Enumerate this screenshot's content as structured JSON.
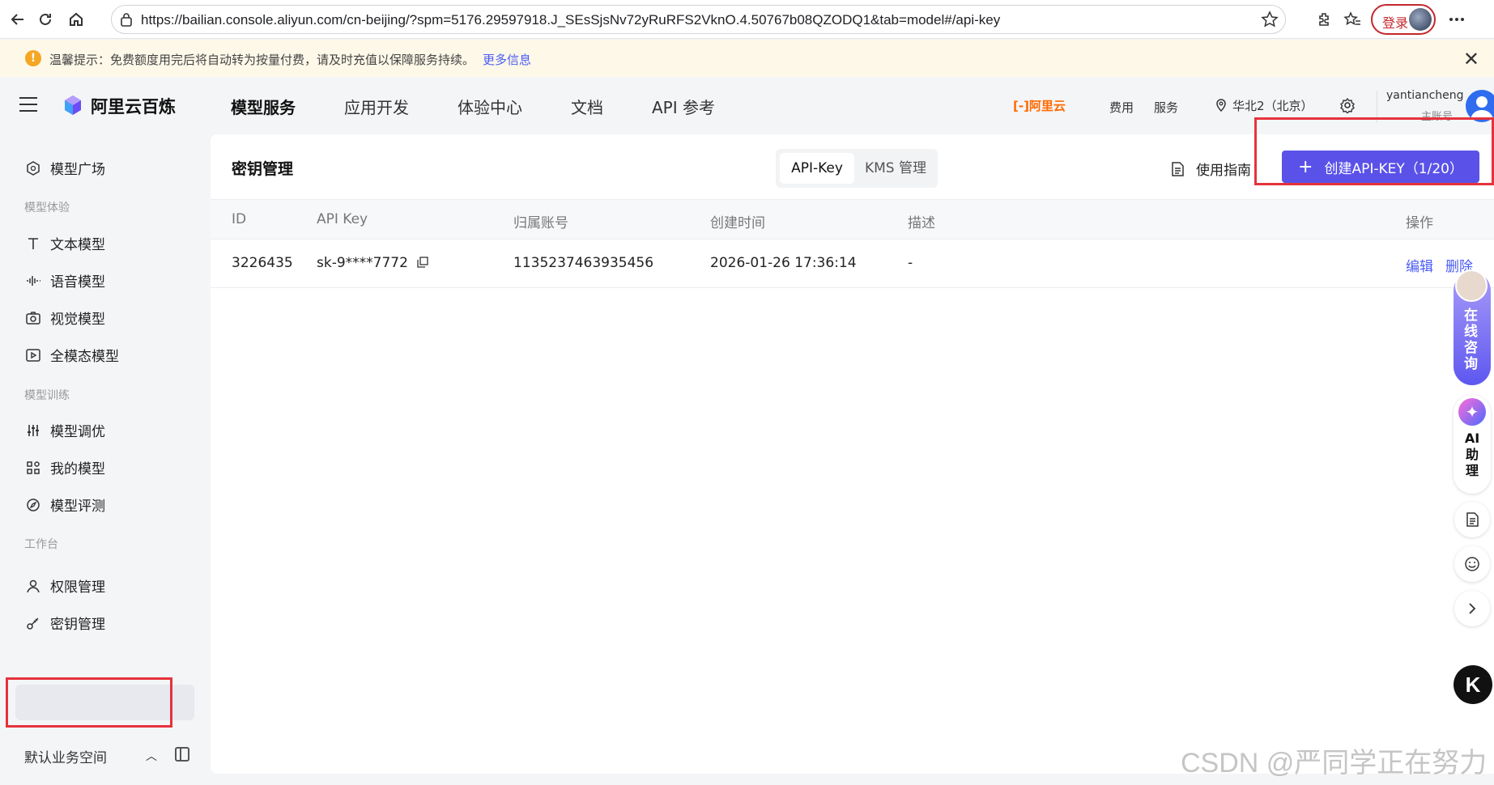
{
  "browser": {
    "url": "https://bailian.console.aliyun.com/cn-beijing/?spm=5176.29597918.J_SEsSjsNv72yRuRFS2VknO.4.50767b08QZODQ1&tab=model#/api-key",
    "login_label": "登录"
  },
  "notice": {
    "text": "温馨提示：免费额度用完后将自动转为按量付费，请及时充值以保障服务持续。",
    "more_link": "更多信息"
  },
  "header": {
    "brand": "阿里云百炼",
    "menu": [
      "模型服务",
      "应用开发",
      "体验中心",
      "文档",
      "API 参考"
    ],
    "aliyun_logo": "[-]阿里云",
    "links": [
      "费用",
      "服务"
    ],
    "region": "华北2（北京）",
    "username": "yantiancheng",
    "user_role": "主账号"
  },
  "sidebar": {
    "model_square": "模型广场",
    "section_experience": "模型体验",
    "experience_items": [
      "文本模型",
      "语音模型",
      "视觉模型",
      "全模态模型"
    ],
    "section_training": "模型训练",
    "training_items": [
      "模型调优",
      "我的模型",
      "模型评测"
    ],
    "section_workbench": "工作台",
    "workbench_items": [
      "权限管理",
      "密钥管理"
    ],
    "active_item": "密钥管理",
    "workspace": "默认业务空间"
  },
  "main": {
    "title": "密钥管理",
    "tabs": [
      "API-Key",
      "KMS 管理"
    ],
    "active_tab": "API-Key",
    "guide": "使用指南",
    "create_button": "创建API-KEY（1/20）",
    "table": {
      "headers": [
        "ID",
        "API Key",
        "归属账号",
        "创建时间",
        "描述",
        "操作"
      ],
      "rows": [
        {
          "id": "3226435",
          "api_key": "sk-9****7772",
          "account": "1135237463935456",
          "created": "2026-01-26 17:36:14",
          "desc": "-",
          "action_edit": "编辑",
          "action_delete": "删除"
        }
      ]
    }
  },
  "floating": {
    "consult": "在线咨询",
    "ai_assistant": "AI助理",
    "k_label": "K"
  },
  "watermark": "CSDN @严同学正在努力",
  "colors": {
    "primary": "#5a52e8",
    "highlight_box": "#e5323c",
    "link": "#4a5cf5",
    "aliyun_orange": "#ff6a00"
  }
}
